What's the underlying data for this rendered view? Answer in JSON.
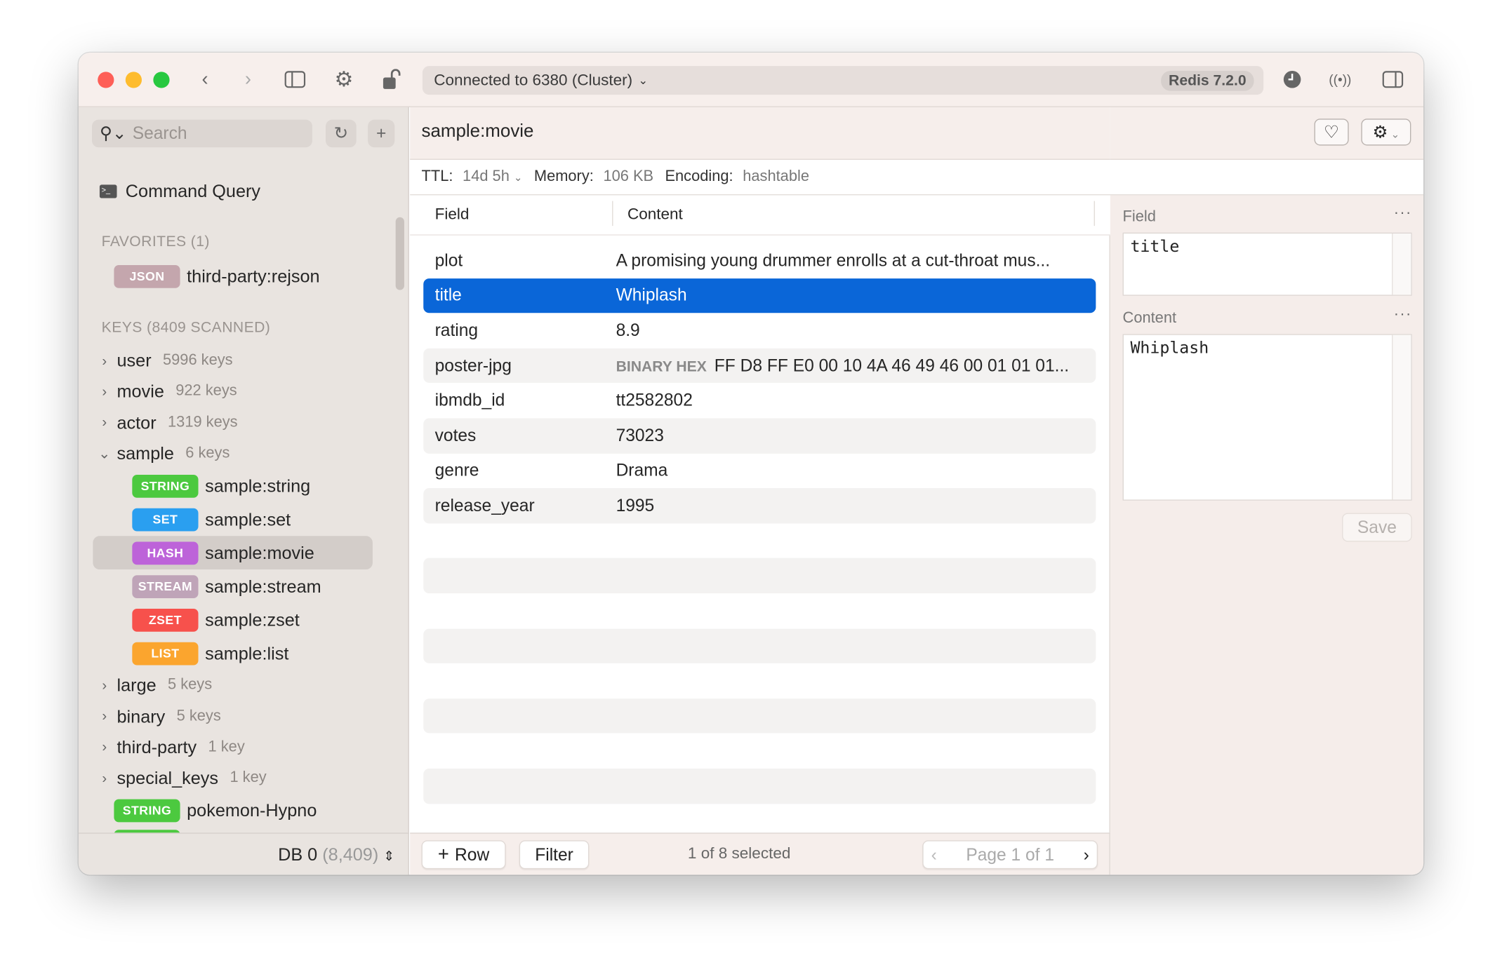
{
  "toolbar": {
    "connection": "Connected to 6380 (Cluster)",
    "redis_version": "Redis 7.2.0"
  },
  "sidebar": {
    "search_placeholder": "Search",
    "command_query": "Command Query",
    "favorites_header": "FAVORITES (1)",
    "favorites": [
      {
        "type": "JSON",
        "name": "third-party:rejson",
        "color": "#c4a6ad"
      }
    ],
    "keys_header": "KEYS (8409 SCANNED)",
    "groups_top": [
      {
        "name": "user",
        "count": "5996 keys"
      },
      {
        "name": "movie",
        "count": "922 keys"
      },
      {
        "name": "actor",
        "count": "1319 keys"
      }
    ],
    "open_group": {
      "name": "sample",
      "count": "6 keys"
    },
    "sample_keys": [
      {
        "type": "STRING",
        "name": "sample:string",
        "color": "#4cc93f"
      },
      {
        "type": "SET",
        "name": "sample:set",
        "color": "#2a9ff0"
      },
      {
        "type": "HASH",
        "name": "sample:movie",
        "color": "#bd63d9",
        "selected": true
      },
      {
        "type": "STREAM",
        "name": "sample:stream",
        "color": "#bfa4b8"
      },
      {
        "type": "ZSET",
        "name": "sample:zset",
        "color": "#f7514c"
      },
      {
        "type": "LIST",
        "name": "sample:list",
        "color": "#fba52e"
      }
    ],
    "groups_bottom": [
      {
        "name": "large",
        "count": "5 keys"
      },
      {
        "name": "binary",
        "count": "5 keys"
      },
      {
        "name": "third-party",
        "count": "1 key"
      },
      {
        "name": "special_keys",
        "count": "1 key"
      }
    ],
    "loose_key": {
      "type": "STRING",
      "name": "pokemon-Hypno",
      "color": "#4cc93f"
    },
    "db_label": "DB 0",
    "db_count": "(8,409)"
  },
  "main": {
    "key_name": "sample:movie",
    "ttl_label": "TTL:",
    "ttl_value": "14d 5h",
    "memory_label": "Memory:",
    "memory_value": "106 KB",
    "encoding_label": "Encoding:",
    "encoding_value": "hashtable",
    "columns": [
      "Field",
      "Content"
    ],
    "rows": [
      {
        "field": "plot",
        "content": "A promising young drummer enrolls at a cut-throat mus..."
      },
      {
        "field": "title",
        "content": "Whiplash",
        "selected": true
      },
      {
        "field": "rating",
        "content": "8.9"
      },
      {
        "field": "poster-jpg",
        "prefix": "BINARY HEX",
        "content": "FF D8 FF E0 00 10 4A 46 49 46 00 01 01 01..."
      },
      {
        "field": "ibmdb_id",
        "content": "tt2582802"
      },
      {
        "field": "votes",
        "content": "73023"
      },
      {
        "field": "genre",
        "content": "Drama"
      },
      {
        "field": "release_year",
        "content": "1995"
      }
    ],
    "add_row": "Row",
    "filter": "Filter",
    "selection_status": "1 of 8 selected",
    "page": "Page 1 of 1"
  },
  "editor": {
    "field_label": "Field",
    "field_value": "title",
    "content_label": "Content",
    "content_value": "Whiplash",
    "save": "Save"
  },
  "colors": {
    "selection": "#0a66d8"
  }
}
